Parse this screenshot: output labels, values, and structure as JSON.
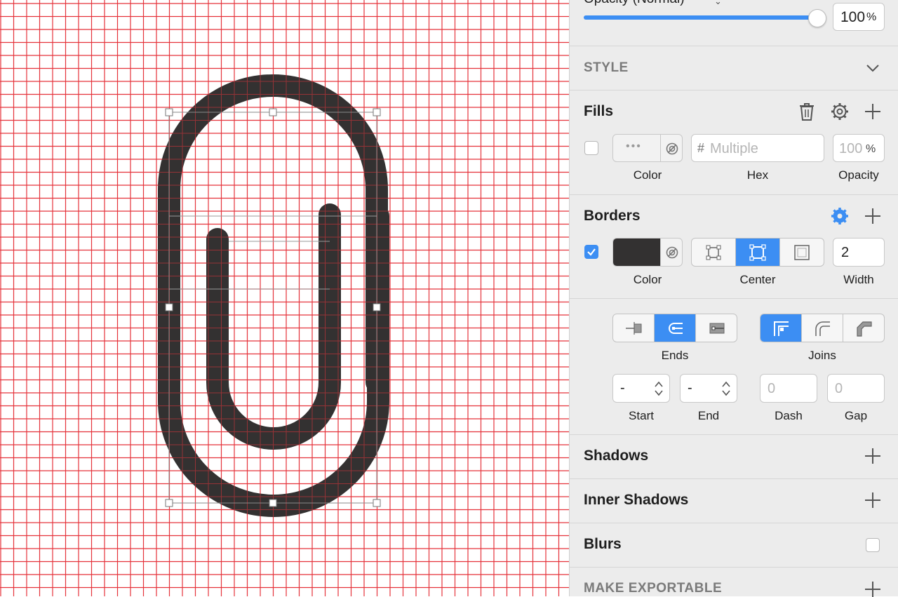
{
  "colors": {
    "accent": "#3c8ef3",
    "grid": "#e5333b",
    "shape": "#333131",
    "panel": "#ececec"
  },
  "opacity": {
    "label": "Opacity (Normal)",
    "value": "100",
    "unit": "%",
    "level": 1.0
  },
  "style": {
    "title": "STYLE"
  },
  "fills": {
    "title": "Fills",
    "hex_prefix": "#",
    "hex_placeholder": "Multiple",
    "opacity_value": "100",
    "opacity_unit": "%",
    "labels": {
      "color": "Color",
      "hex": "Hex",
      "opacity": "Opacity"
    },
    "dots": "•••"
  },
  "borders": {
    "title": "Borders",
    "width": "2",
    "labels": {
      "color": "Color",
      "position": "Center",
      "width": "Width"
    },
    "position_selected": "Center"
  },
  "ends": {
    "label": "Ends",
    "selected": "round"
  },
  "joins": {
    "label": "Joins",
    "selected": "miter"
  },
  "arrows": {
    "start_value": "-",
    "end_value": "-",
    "start_label": "Start",
    "end_label": "End"
  },
  "dash": {
    "placeholder": "0",
    "label": "Dash"
  },
  "gap": {
    "placeholder": "0",
    "label": "Gap"
  },
  "shadows": {
    "title": "Shadows"
  },
  "inner_shadows": {
    "title": "Inner Shadows"
  },
  "blurs": {
    "title": "Blurs"
  },
  "exportable": {
    "title": "MAKE EXPORTABLE"
  }
}
